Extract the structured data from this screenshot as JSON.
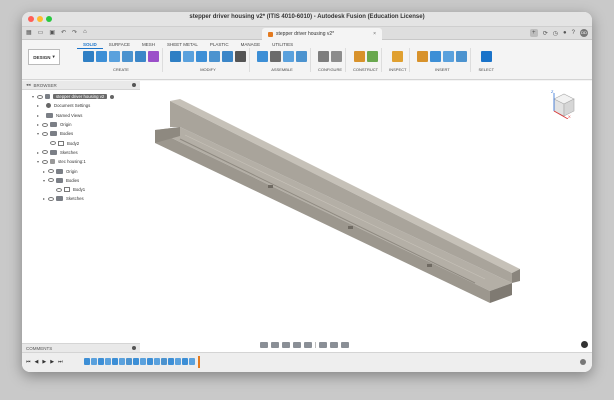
{
  "window": {
    "title": "stepper driver housing v2* (ITIS 4010-6010) - Autodesk Fusion (Education License)"
  },
  "tabbar": {
    "doc_tab_label": "stepper driver housing v2*",
    "close_symbol": "×",
    "plus_symbol": "+",
    "user_initials": "DD"
  },
  "toolbar": {
    "workspace_label": "DESIGN",
    "ribbon_tabs": [
      "SOLID",
      "SURFACE",
      "MESH",
      "SHEET METAL",
      "PLASTIC",
      "MANAGE",
      "UTILITIES"
    ],
    "groups": [
      "CREATE",
      "MODIFY",
      "ASSEMBLE",
      "CONFIGURE",
      "CONSTRUCT",
      "INSPECT",
      "INSERT",
      "SELECT"
    ]
  },
  "browser": {
    "title": "BROWSER",
    "items": [
      {
        "label": "stepper driver housing v2"
      },
      {
        "label": "Document Settings"
      },
      {
        "label": "Named Views"
      },
      {
        "label": "Origin"
      },
      {
        "label": "Bodies"
      },
      {
        "label": "Body2"
      },
      {
        "label": "Sketches"
      },
      {
        "label": "stec housing:1"
      },
      {
        "label": "Origin"
      },
      {
        "label": "Bodies"
      },
      {
        "label": "Body1"
      },
      {
        "label": "Sketches"
      }
    ]
  },
  "comments": {
    "title": "COMMENTS"
  },
  "viewcube": {
    "axis_z": "Z",
    "axis_x": "X"
  },
  "colors": {
    "accent": "#1a73c9",
    "model_top": "#b4afa6",
    "model_front": "#9c978e",
    "model_dark": "#7f7a72"
  }
}
